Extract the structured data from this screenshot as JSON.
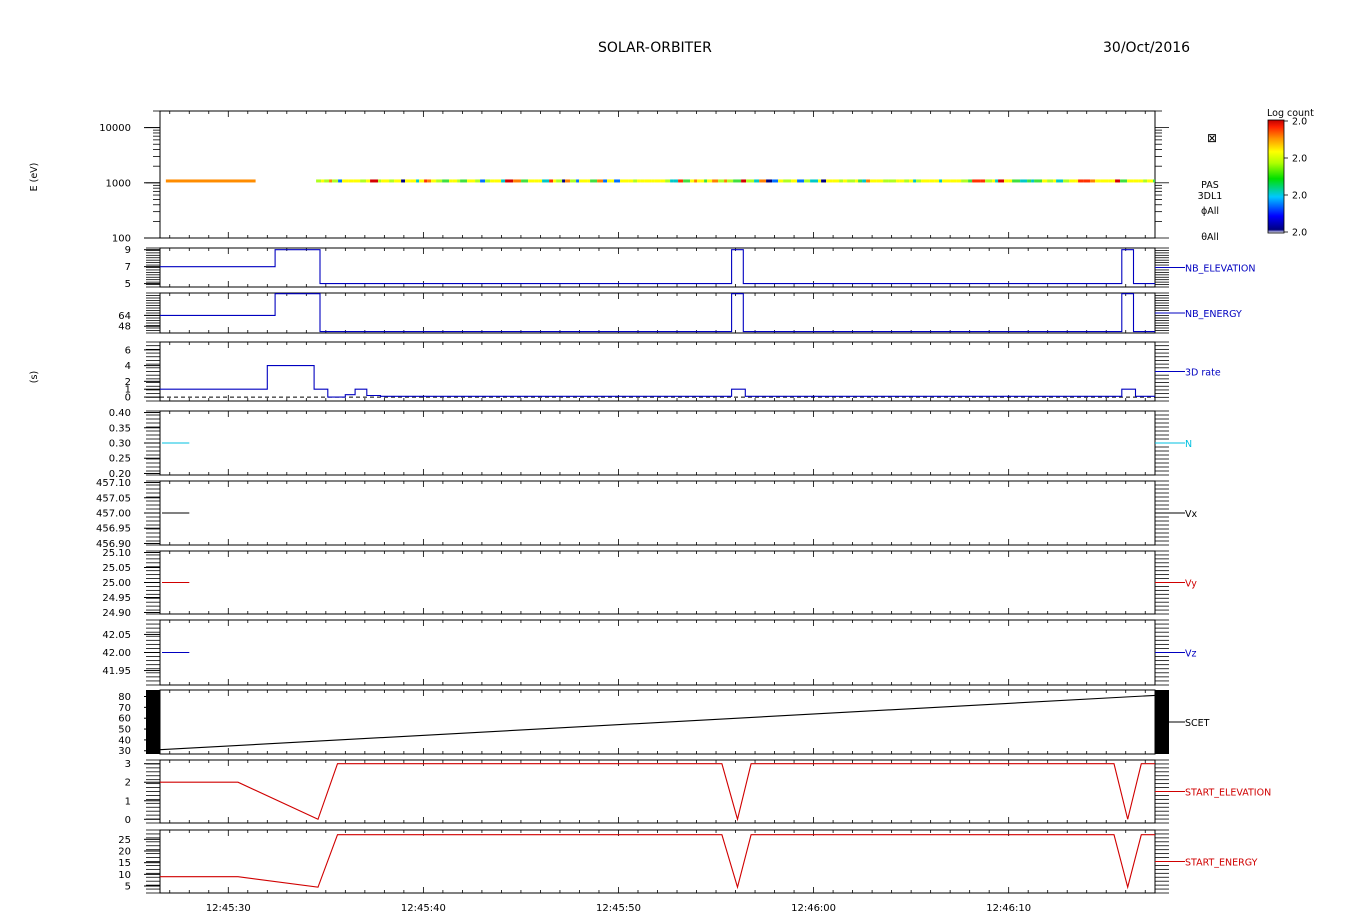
{
  "header": {
    "title": "SOLAR-ORBITER",
    "date": "30/Oct/2016"
  },
  "time_axis": {
    "ticks": [
      "12:45:30",
      "12:45:40",
      "12:45:50",
      "12:46:00",
      "12:46:10"
    ],
    "start_s": 26.5,
    "end_s": 77.5,
    "tick_s": [
      30,
      40,
      50,
      60,
      70
    ]
  },
  "colorbar": {
    "title": "Log count",
    "labels": [
      "2.0",
      "2.0",
      "2.0",
      "2.0"
    ]
  },
  "side_labels": {
    "energy": "E (eV)",
    "seconds": "(s)"
  },
  "spectrogram_labels": {
    "icon": "⊠",
    "line1": "PAS",
    "line2": "3DL1",
    "line3": "ϕAll",
    "line4": "θAll"
  },
  "chart_data": [
    {
      "type": "heatmap",
      "name_label": "",
      "ylabel": "E (eV)",
      "yscale": "log",
      "ylim": [
        100,
        20000
      ],
      "yticks": [
        {
          "v": 10000,
          "label": "10000"
        },
        {
          "v": 1000,
          "label": "1000"
        },
        {
          "v": 100,
          "label": "100"
        }
      ],
      "energy": 1080,
      "segments": [
        {
          "t0": 26.8,
          "t1": 31.4,
          "color": "#ff8c00",
          "pattern": "solid"
        },
        {
          "t0": 34.5,
          "t1": 77.5,
          "color": "mixed",
          "pattern": "speckle"
        }
      ],
      "palette": [
        "#ffff00",
        "#b0ff20",
        "#40e040",
        "#00c8c8",
        "#0070ff",
        "#ff8000",
        "#ff3000",
        "#d40000",
        "#000080"
      ]
    },
    {
      "type": "line",
      "name_label": "NB_ELEVATION",
      "color": "#0000c0",
      "step": true,
      "ylim": [
        4.6,
        9.2
      ],
      "yticks": [
        {
          "v": 9,
          "label": "9"
        },
        {
          "v": 7,
          "label": "7"
        },
        {
          "v": 5,
          "label": "5"
        }
      ],
      "x": [
        26.5,
        32.4,
        32.4,
        34.7,
        34.7,
        55.8,
        55.8,
        56.4,
        56.4,
        75.8,
        75.8,
        76.4,
        76.4,
        77.5
      ],
      "y": [
        7,
        7,
        9,
        9,
        5,
        5,
        9,
        9,
        5,
        5,
        9,
        9,
        5,
        5
      ]
    },
    {
      "type": "line",
      "name_label": "NB_ENERGY",
      "color": "#0000c0",
      "step": true,
      "ylim": [
        38,
        97
      ],
      "yticks": [
        {
          "v": 64,
          "label": "64"
        },
        {
          "v": 48,
          "label": "48"
        }
      ],
      "x": [
        26.5,
        32.4,
        32.4,
        34.7,
        34.7,
        55.8,
        55.8,
        56.4,
        56.4,
        75.8,
        75.8,
        76.4,
        76.4,
        77.5
      ],
      "y": [
        64,
        64,
        96,
        96,
        40,
        40,
        96,
        96,
        40,
        40,
        96,
        96,
        40,
        40
      ]
    },
    {
      "type": "line",
      "name_label": "3D rate",
      "color": "#0000c0",
      "step": true,
      "ylim": [
        -0.5,
        7
      ],
      "yticks": [
        {
          "v": 6,
          "label": "6"
        },
        {
          "v": 4,
          "label": "4"
        },
        {
          "v": 2,
          "label": "2"
        },
        {
          "v": 1,
          "label": "1"
        },
        {
          "v": 0,
          "label": "0"
        }
      ],
      "x": [
        26.5,
        32,
        32,
        34.4,
        34.4,
        35.1,
        35.1,
        36.0,
        36.0,
        36.5,
        36.5,
        37.1,
        37.1,
        37.8,
        37.8,
        55.8,
        55.8,
        56.5,
        56.5,
        75.8,
        75.8,
        76.5,
        76.5,
        77.5
      ],
      "y": [
        1,
        1,
        4,
        4,
        1,
        1,
        0,
        0,
        0.3,
        0.3,
        1,
        1,
        0.2,
        0.2,
        0.1,
        0.1,
        1,
        1,
        0.1,
        0.1,
        1,
        1,
        0.1,
        0.1
      ],
      "dashed_zero": true
    },
    {
      "type": "line",
      "name_label": "N",
      "color": "#00c0e0",
      "ylim": [
        0.195,
        0.405
      ],
      "yticks": [
        {
          "v": 0.4,
          "label": "0.40"
        },
        {
          "v": 0.35,
          "label": "0.35"
        },
        {
          "v": 0.3,
          "label": "0.30"
        },
        {
          "v": 0.25,
          "label": "0.25"
        },
        {
          "v": 0.2,
          "label": "0.20"
        }
      ],
      "x": [
        26.6,
        28.0
      ],
      "y": [
        0.3,
        0.3
      ]
    },
    {
      "type": "line",
      "name_label": "Vx",
      "color": "#000000",
      "ylim": [
        456.895,
        457.105
      ],
      "yticks": [
        {
          "v": 457.1,
          "label": "457.10"
        },
        {
          "v": 457.05,
          "label": "457.05"
        },
        {
          "v": 457.0,
          "label": "457.00"
        },
        {
          "v": 456.95,
          "label": "456.95"
        },
        {
          "v": 456.9,
          "label": "456.90"
        }
      ],
      "x": [
        26.6,
        28.0
      ],
      "y": [
        457.0,
        457.0
      ]
    },
    {
      "type": "line",
      "name_label": "Vy",
      "color": "#d00000",
      "ylim": [
        24.895,
        25.105
      ],
      "yticks": [
        {
          "v": 25.1,
          "label": "25.10"
        },
        {
          "v": 25.05,
          "label": "25.05"
        },
        {
          "v": 25.0,
          "label": "25.00"
        },
        {
          "v": 24.95,
          "label": "24.95"
        },
        {
          "v": 24.9,
          "label": "24.90"
        }
      ],
      "x": [
        26.6,
        28.0
      ],
      "y": [
        25.0,
        25.0
      ]
    },
    {
      "type": "line",
      "name_label": "Vz",
      "color": "#0000c0",
      "ylim": [
        41.91,
        42.09
      ],
      "yticks": [
        {
          "v": 42.05,
          "label": "42.05"
        },
        {
          "v": 42.0,
          "label": "42.00"
        },
        {
          "v": 41.95,
          "label": "41.95"
        }
      ],
      "x": [
        26.6,
        28.0
      ],
      "y": [
        42.0,
        42.0
      ]
    },
    {
      "type": "line",
      "name_label": "SCET",
      "color": "#000000",
      "ylim": [
        27,
        86
      ],
      "yticks": [
        {
          "v": 80,
          "label": "80"
        },
        {
          "v": 70,
          "label": "70"
        },
        {
          "v": 60,
          "label": "60"
        },
        {
          "v": 50,
          "label": "50"
        },
        {
          "v": 40,
          "label": "40"
        },
        {
          "v": 30,
          "label": "30"
        }
      ],
      "x": [
        26.5,
        77.5
      ],
      "y": [
        31,
        81
      ]
    },
    {
      "type": "line",
      "name_label": "START_ELEVATION",
      "color": "#d00000",
      "ylim": [
        -0.2,
        3.2
      ],
      "yticks": [
        {
          "v": 3,
          "label": "3"
        },
        {
          "v": 2,
          "label": "2"
        },
        {
          "v": 1,
          "label": "1"
        },
        {
          "v": 0,
          "label": "0"
        }
      ],
      "x": [
        26.5,
        30.5,
        34.6,
        35.6,
        55.3,
        56.1,
        56.8,
        75.4,
        76.1,
        76.8,
        77.5
      ],
      "y": [
        2,
        2,
        0,
        3,
        3,
        0,
        3,
        3,
        0,
        3,
        3
      ]
    },
    {
      "type": "line",
      "name_label": "START_ENERGY",
      "color": "#d00000",
      "ylim": [
        2,
        29
      ],
      "yticks": [
        {
          "v": 25,
          "label": "25"
        },
        {
          "v": 20,
          "label": "20"
        },
        {
          "v": 15,
          "label": "15"
        },
        {
          "v": 10,
          "label": "10"
        },
        {
          "v": 5,
          "label": "5"
        }
      ],
      "x": [
        26.5,
        30.5,
        34.6,
        35.6,
        55.3,
        56.1,
        56.8,
        75.4,
        76.1,
        76.8,
        77.5
      ],
      "y": [
        9,
        9,
        4.5,
        27,
        27,
        4.5,
        27,
        27,
        4.5,
        27,
        27
      ]
    }
  ]
}
